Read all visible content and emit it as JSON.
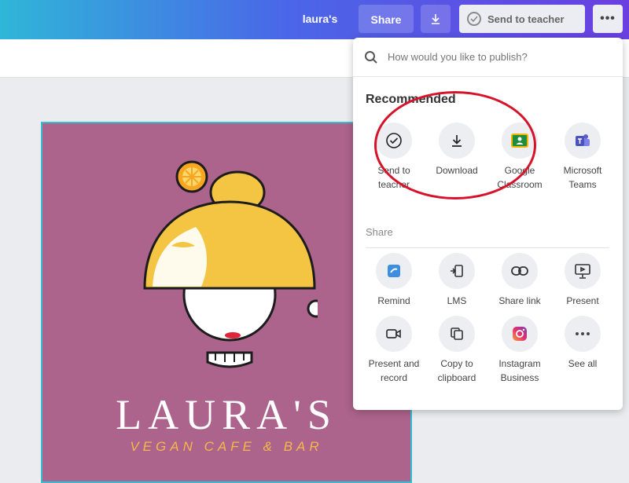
{
  "topbar": {
    "project_name": "laura's",
    "share_label": "Share",
    "download_icon": "download-icon",
    "send_to_teacher_label": "Send to teacher",
    "more_label": "•••"
  },
  "publish_menu": {
    "search_placeholder": "How would you like to publish?",
    "recommended_title": "Recommended",
    "recommended": [
      {
        "label": "Send to teacher",
        "icon": "check-circle-icon"
      },
      {
        "label": "Download",
        "icon": "download-icon"
      },
      {
        "label": "Google Classroom",
        "icon": "google-classroom-icon"
      },
      {
        "label": "Microsoft Teams",
        "icon": "microsoft-teams-icon"
      }
    ],
    "share_title": "Share",
    "share": [
      {
        "label": "Remind",
        "icon": "remind-icon"
      },
      {
        "label": "LMS",
        "icon": "lms-icon"
      },
      {
        "label": "Share link",
        "icon": "link-icon"
      },
      {
        "label": "Present",
        "icon": "present-icon"
      },
      {
        "label": "Present and record",
        "icon": "video-camera-icon"
      },
      {
        "label": "Copy to clipboard",
        "icon": "copy-icon"
      },
      {
        "label": "Instagram Business",
        "icon": "instagram-icon"
      },
      {
        "label": "See all",
        "icon": "more-icon"
      }
    ]
  },
  "design": {
    "brand_name": "LAURA'S",
    "tagline": "VEGAN CAFE & BAR",
    "background_color": "#ac638c"
  },
  "colors": {
    "annotation": "#d6132a",
    "accent": "#4a67e8"
  }
}
